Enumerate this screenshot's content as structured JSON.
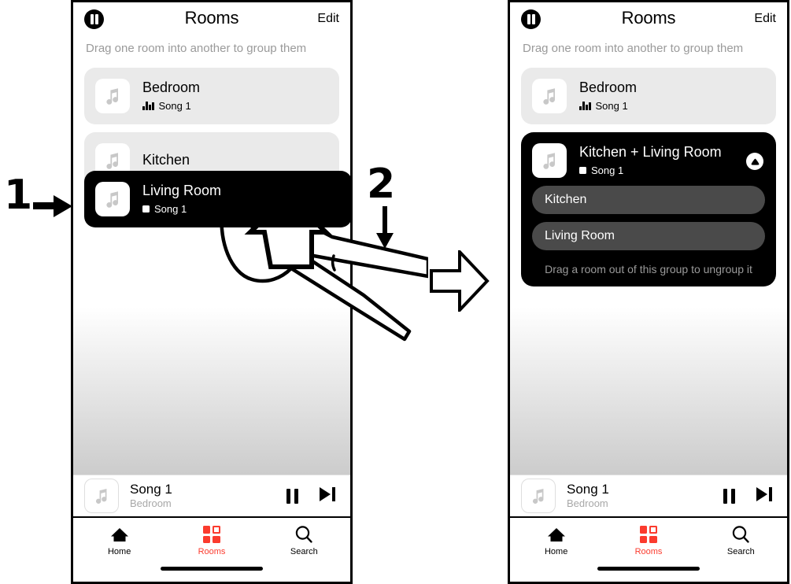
{
  "figure": {
    "steps": [
      {
        "number": "1",
        "direction": "right"
      },
      {
        "number": "2",
        "direction": "down"
      }
    ],
    "transition_arrow": "hollow-right-arrow"
  },
  "screens": [
    {
      "id": "before",
      "header": {
        "pause_badge": "pause-icon",
        "title": "Rooms",
        "edit_label": "Edit"
      },
      "subtitle": "Drag one room into another to group them",
      "rooms": [
        {
          "name": "Bedroom",
          "now_playing": "Song 1",
          "status_icon": "equalizer-icon",
          "style": "light"
        },
        {
          "name": "Kitchen",
          "now_playing": "",
          "status_icon": "",
          "style": "light"
        }
      ],
      "drag_card": {
        "name": "Living Room",
        "now_playing": "Song 1",
        "status_icon": "stop-square-icon"
      },
      "now_playing_bar": {
        "title": "Song 1",
        "subtitle": "Bedroom",
        "pause_label": "pause-icon",
        "next_label": "next-track-icon"
      },
      "tabs": [
        {
          "label": "Home",
          "icon": "home-icon",
          "active": false
        },
        {
          "label": "Rooms",
          "icon": "rooms-icon",
          "active": true
        },
        {
          "label": "Search",
          "icon": "search-icon",
          "active": false
        }
      ]
    },
    {
      "id": "after",
      "header": {
        "pause_badge": "pause-icon",
        "title": "Rooms",
        "edit_label": "Edit"
      },
      "subtitle": "Drag one room into another to group them",
      "rooms": [
        {
          "name": "Bedroom",
          "now_playing": "Song 1",
          "status_icon": "equalizer-icon",
          "style": "light"
        }
      ],
      "group": {
        "title": "Kitchen + Living Room",
        "now_playing": "Song 1",
        "status_icon": "stop-square-icon",
        "collapse_icon": "collapse-up-icon",
        "members": [
          "Kitchen",
          "Living Room"
        ],
        "hint": "Drag a room out of this group to ungroup it"
      },
      "now_playing_bar": {
        "title": "Song 1",
        "subtitle": "Bedroom",
        "pause_label": "pause-icon",
        "next_label": "next-track-icon"
      },
      "tabs": [
        {
          "label": "Home",
          "icon": "home-icon",
          "active": false
        },
        {
          "label": "Rooms",
          "icon": "rooms-icon",
          "active": true
        },
        {
          "label": "Search",
          "icon": "search-icon",
          "active": false
        }
      ]
    }
  ],
  "colors": {
    "accent": "#fb3b2e",
    "card_light": "#eaeaea",
    "card_dark": "#000000",
    "member_pill": "#4a4a4a",
    "muted_text": "#9a9a9a"
  }
}
